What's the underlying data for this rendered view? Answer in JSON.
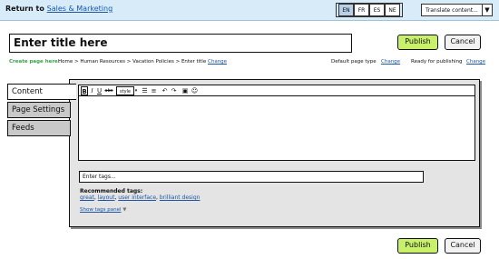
{
  "topbar": {
    "return_prefix": "Return to",
    "return_link": "Sales & Marketing",
    "languages": [
      "EN",
      "FR",
      "ES",
      "NE"
    ],
    "translate_label": "Translate content..."
  },
  "title_placeholder": "Enter title here",
  "actions": {
    "publish": "Publish",
    "cancel": "Cancel"
  },
  "path_row": {
    "create_label": "Create page here:",
    "breadcrumb": "Home > Human Resources > Vacation Policies > Enter title",
    "change": "Change",
    "default_type_label": "Default page type",
    "ready_label": "Ready for publishing"
  },
  "tabs": [
    "Content",
    "Page Settings",
    "Feeds"
  ],
  "toolbar": {
    "bold": "B",
    "italic": "I",
    "underline": "U",
    "strike": "abc",
    "style": "style"
  },
  "tags": {
    "placeholder": "Enter tags...",
    "recommended_label": "Recommended tags:",
    "items": [
      "great",
      "layout",
      "user interface",
      "brilliant design"
    ],
    "show_panel": "Show tags panel"
  },
  "colors": {
    "publish": "#c9f06a",
    "link": "#1a55a8",
    "topbar": "#d7ecf8",
    "create_label": "#39a34a"
  }
}
